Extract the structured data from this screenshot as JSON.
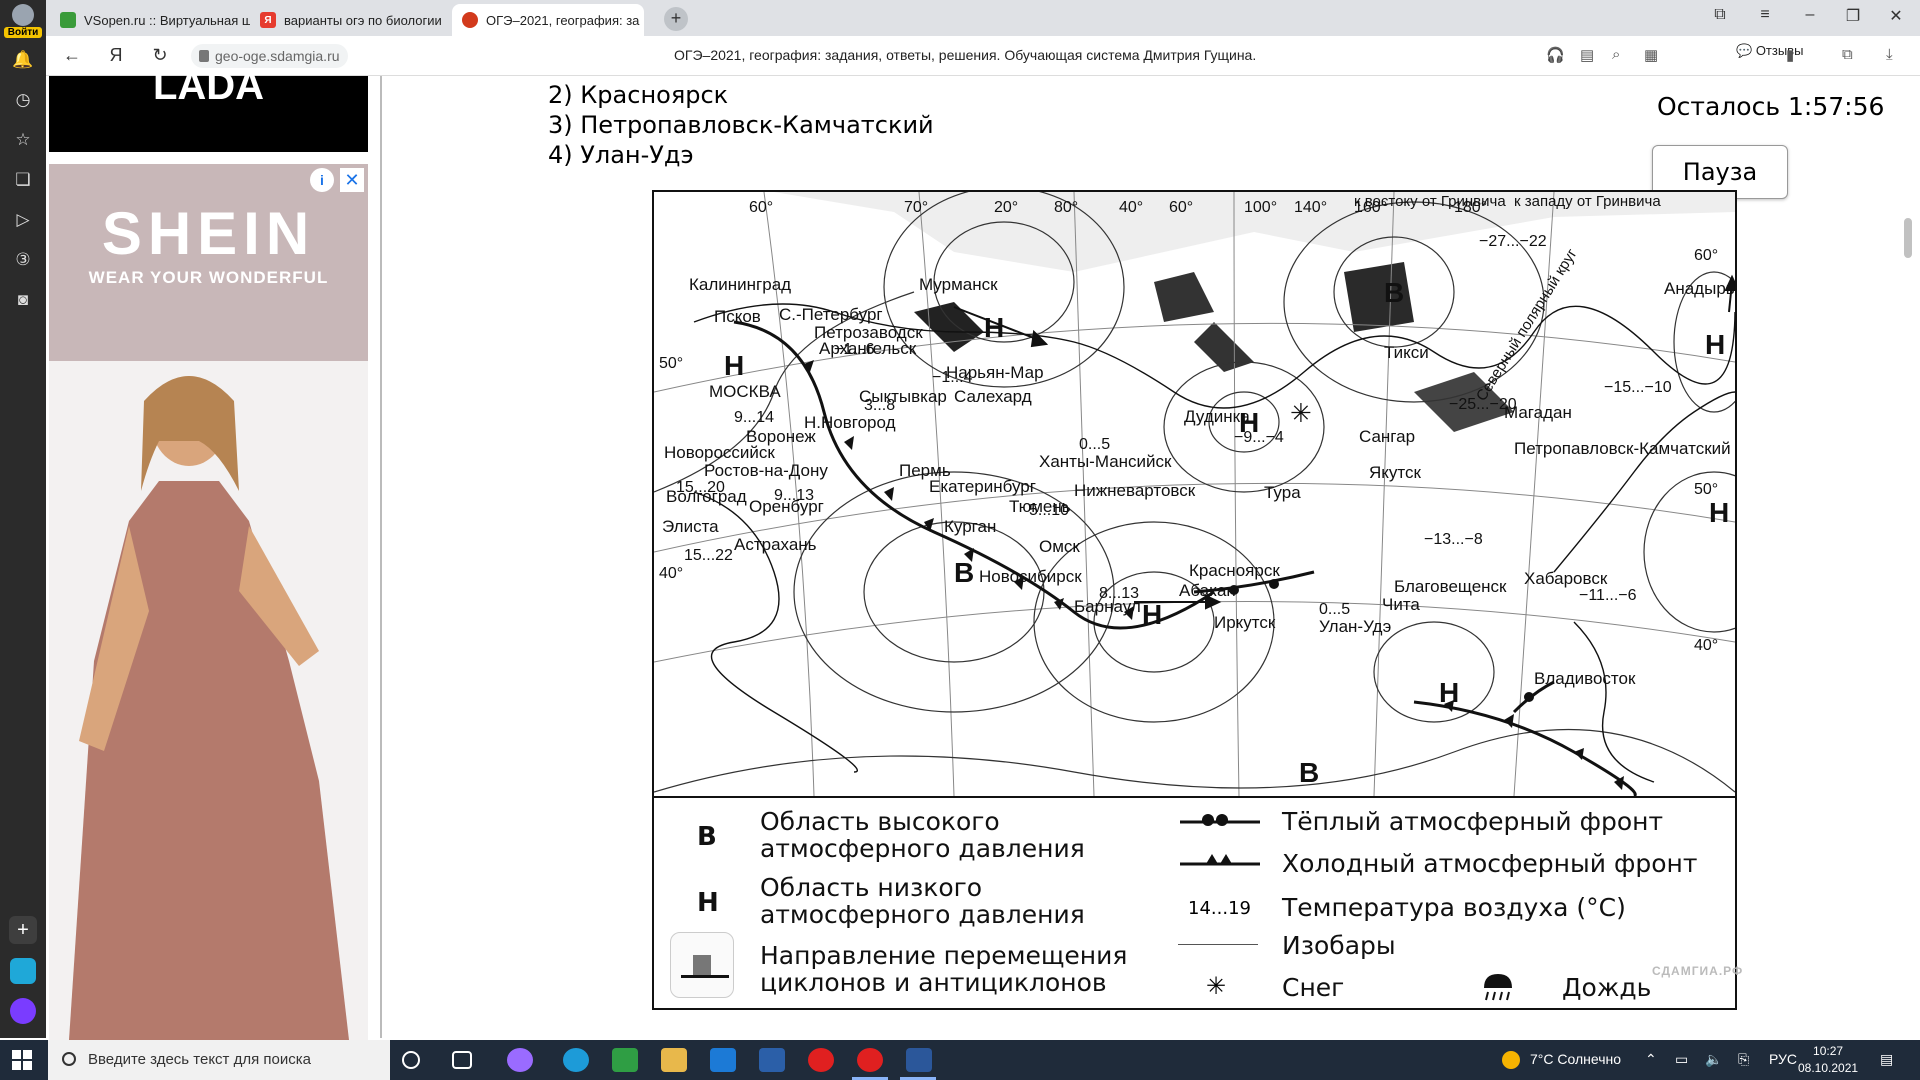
{
  "browser": {
    "user_login": "Войти",
    "tabs": [
      {
        "label": "VSopen.ru :: Виртуальная ш",
        "favicon": "vsopen-icon",
        "color": "#3a9b3a"
      },
      {
        "label": "варианты огэ по биологии",
        "favicon": "yandex-icon",
        "color": "#e63b2e"
      },
      {
        "label": "ОГЭ–2021, география: за",
        "favicon": "sdamgia-icon",
        "color": "#d23a1c"
      }
    ],
    "address_domain": "geo-oge.sdamgia.ru",
    "page_title": "ОГЭ–2021, география: задания, ответы, решения. Обучающая система Дмитрия Гущина.",
    "reviews_label": "Отзывы"
  },
  "ads": {
    "top_brand": "LADA",
    "shein_brand": "SHEIN",
    "shein_tagline": "WEAR YOUR WONDERFUL"
  },
  "question": {
    "options": [
      "2) Красноярск",
      "3) Петропавловск-Камчатский",
      "4) Улан-Удэ"
    ],
    "timer": "Осталось 1:57:56",
    "pause_label": "Пауза"
  },
  "map": {
    "cities": [
      "Калининград",
      "Псков",
      "С.-Петербург",
      "Петрозаводск",
      "Архангельск",
      "Мурманск",
      "Нарьян-Мар",
      "МОСКВА",
      "Сыктывкар",
      "Салехард",
      "Н.Новгород",
      "Воронеж",
      "Новороссийск",
      "Ростов-на-Дону",
      "Волгоград",
      "Оренбург",
      "Элиста",
      "Астрахань",
      "Пермь",
      "Екатеринбург",
      "Тюмень",
      "Курган",
      "Омск",
      "Ханты-Мансийск",
      "Нижневартовск",
      "Новосибирск",
      "Барнаул",
      "Абакан",
      "Красноярск",
      "Иркутск",
      "Улан-Удэ",
      "Чита",
      "Благовещенск",
      "Хабаровск",
      "Владивосток",
      "Дудинка",
      "Тура",
      "Якутск",
      "Сангар",
      "Тикси",
      "Магадан",
      "Петропавловск-Камчатский",
      "Анадырь"
    ],
    "temperatures": [
      "−1...6",
      "−1...4",
      "3...8",
      "9...14",
      "15...20",
      "9...13",
      "15...22",
      "0...5",
      "5...10",
      "8...13",
      "−9...−4",
      "−25...−20",
      "−27...−22",
      "−15...−10",
      "−13...−8",
      "−11...−6",
      "0...5"
    ],
    "degrees": [
      "60°",
      "70°",
      "20°",
      "80°",
      "40°",
      "60°",
      "100°",
      "140°",
      "160°",
      "180°",
      "50°",
      "40°",
      "60°",
      "50°",
      "40°"
    ],
    "east_label": "к востоку от Гринвича",
    "west_label": "к западу от Гринвича",
    "polar_circle": "Северный полярный круг"
  },
  "legend": {
    "high_symbol": "В",
    "high_label": "Область высокого атмосферного давления",
    "low_symbol": "Н",
    "low_label": "Область низкого атмосферного давления",
    "movement_label": "Направление перемещения циклонов и антициклонов",
    "warm_front": "Тёплый атмосферный фронт",
    "cold_front": "Холодный атмосферный фронт",
    "temp_sample": "14...19",
    "temp_label": "Температура воздуха (°С)",
    "isobars_label": "Изобары",
    "snow_symbol": "✳",
    "snow_label": "Снег",
    "rain_label": "Дождь",
    "watermark": "СДАМГИА.РФ"
  },
  "taskbar": {
    "search_placeholder": "Введите здесь текст для поиска",
    "weather": "7°C Солнечно",
    "lang": "РУС",
    "time": "10:27",
    "date": "08.10.2021"
  }
}
